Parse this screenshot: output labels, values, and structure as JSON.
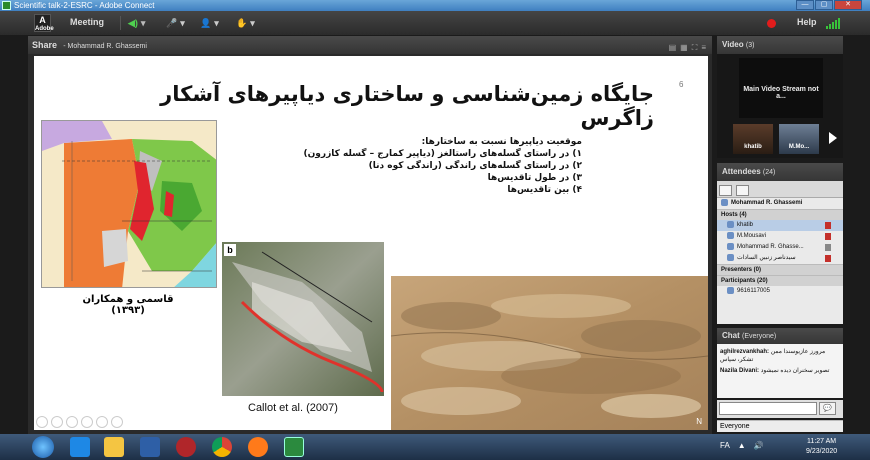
{
  "window": {
    "title": "Scientific talk-2-ESRC - Adobe Connect",
    "buttons": [
      "—",
      "▢",
      "✕"
    ]
  },
  "menubar": {
    "logo_text": "Adobe",
    "meeting": "Meeting",
    "controls": [
      "◀)",
      "▾",
      "🎤",
      "▾",
      "👤",
      "▾",
      "✋",
      "▾"
    ],
    "help": "Help"
  },
  "share_pod": {
    "title": "Share",
    "presenter": "- Mohammad R. Ghassemi",
    "ctrl_icons": [
      "▤",
      "▦",
      "⛶",
      "≡"
    ]
  },
  "slide": {
    "number": "6",
    "title": "جایگاه زمین‌شناسی و ساختاری دیاپیرهای آشکار زاگرس",
    "bullets": [
      "موقعیت دیاپیرها نسبت به ساختارها:",
      "۱) در راستای گسله‌های راستالغز (دیاپیر کمارج – گسله کازرون)",
      "۲) در راستای گسله‌های راندگی (راندگی کوه دنا)",
      "۳) در طول تاقدیس‌ها",
      "۴) بین تاقدیس‌ها"
    ],
    "map_caption": "قاسمی و همکاران (۱۳۹۳)",
    "photo_label": "b",
    "photo_caption": "Callot et al. (2007)",
    "sat_north": "N"
  },
  "video_pod": {
    "title": "Video",
    "count": "(3)",
    "main_label": "Main Video Stream not a...",
    "thumbs": [
      "khatib",
      "M.Mo..."
    ]
  },
  "attendees": {
    "title": "Attendees",
    "count": "(24)",
    "me": "Mohammad R. Ghassemi",
    "hosts_label": "Hosts (4)",
    "hosts": [
      "khatib",
      "M.Mousavi",
      "Mohammad R. Ghasse...",
      "سیدناصر زنبیں السادات"
    ],
    "presenters_label": "Presenters (0)",
    "participants_label": "Participants (20)",
    "participants": [
      "9616117005"
    ]
  },
  "chat": {
    "title": "Chat",
    "scope": "(Everyone)",
    "messages": [
      {
        "from": "aghilrezvankhah:",
        "text": "مرورز عازیوسندا ممن تشکر، سپاس"
      },
      {
        "from": "Nazila Divani:",
        "text": "تصویر سخنران دیده نمیشود"
      }
    ],
    "send_icon": "💬",
    "target": "Everyone"
  },
  "taskbar": {
    "tray": [
      "FA",
      "▲",
      "🔊"
    ],
    "time": "11:27 AM",
    "date": "9/23/2020"
  },
  "colors": {
    "accent_red": "#e21c1c",
    "pod_header": "#3c3c3c",
    "signal_green": "#38c43a"
  }
}
